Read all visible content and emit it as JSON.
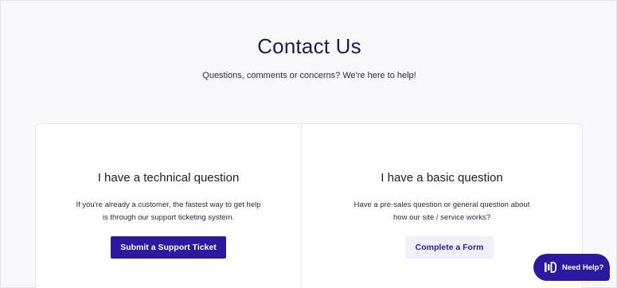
{
  "header": {
    "title": "Contact Us",
    "subtitle": "Questions, comments or concerns? We're here to help!"
  },
  "columns": [
    {
      "title": "I have a technical question",
      "text": "If you're already a customer, the fastest way to get help is through our support ticketing system.",
      "button_label": "Submit a Support Ticket"
    },
    {
      "title": "I have a basic question",
      "text": "Have a pre-sales question or general question about how our site / service works?",
      "button_label": "Complete a Form"
    }
  ],
  "help_widget": {
    "label": "Need Help?",
    "icon": "chat-bars-icon"
  },
  "colors": {
    "brand": "#2b1aa0",
    "background": "#f8f8fa",
    "title": "#1d1b4f"
  }
}
